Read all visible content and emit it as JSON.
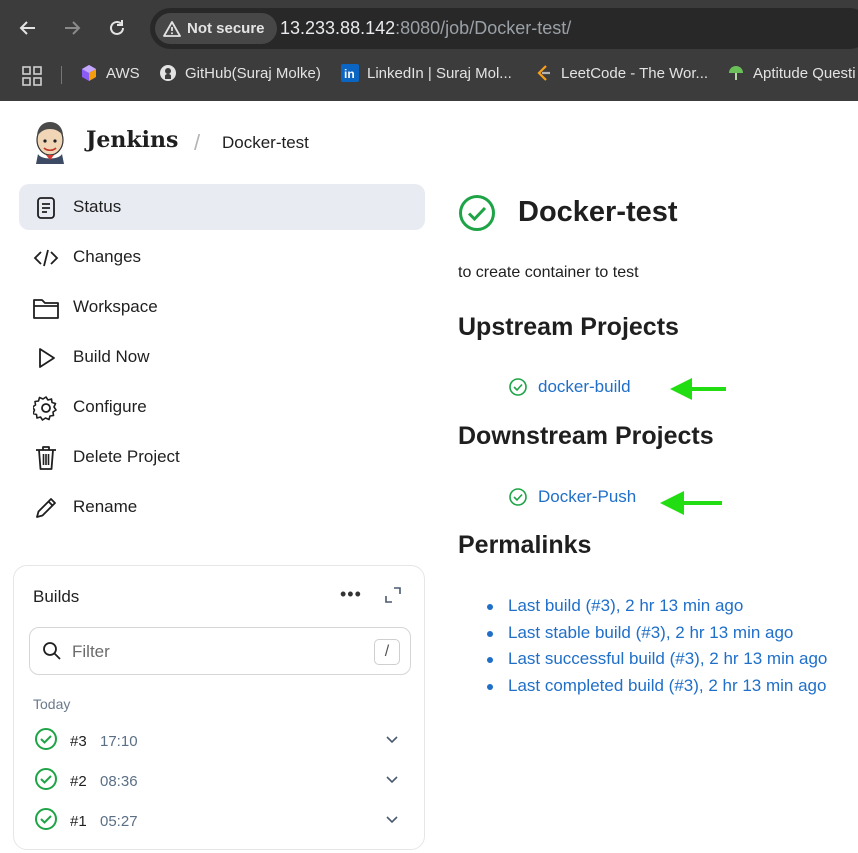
{
  "browser": {
    "security_label": "Not secure",
    "url_host": "13.233.88.142",
    "url_rest": ":8080/job/Docker-test/",
    "bookmarks": [
      {
        "label": "AWS",
        "icon": "aws-cube-icon"
      },
      {
        "label": "GitHub(Suraj Molke)",
        "icon": "github-icon"
      },
      {
        "label": "LinkedIn | Suraj Mol...",
        "icon": "linkedin-icon"
      },
      {
        "label": "LeetCode - The Wor...",
        "icon": "leetcode-icon"
      },
      {
        "label": "Aptitude Questi",
        "icon": "aptitude-icon"
      }
    ]
  },
  "header": {
    "brand": "Jenkins",
    "separator": "/",
    "breadcrumb": "Docker-test"
  },
  "sidebar": {
    "items": [
      {
        "label": "Status",
        "icon": "status-document-icon",
        "active": true
      },
      {
        "label": "Changes",
        "icon": "code-icon"
      },
      {
        "label": "Workspace",
        "icon": "folder-icon"
      },
      {
        "label": "Build Now",
        "icon": "play-icon"
      },
      {
        "label": "Configure",
        "icon": "gear-icon"
      },
      {
        "label": "Delete Project",
        "icon": "trash-icon"
      },
      {
        "label": "Rename",
        "icon": "pencil-icon"
      }
    ]
  },
  "builds": {
    "title": "Builds",
    "more": "•••",
    "filter_placeholder": "Filter",
    "filter_shortcut": "/",
    "group_label": "Today",
    "rows": [
      {
        "number": "#3",
        "time": "17:10",
        "status": "success"
      },
      {
        "number": "#2",
        "time": "08:36",
        "status": "success"
      },
      {
        "number": "#1",
        "time": "05:27",
        "status": "success"
      }
    ]
  },
  "main": {
    "title": "Docker-test",
    "description": "to create container to test",
    "upstream_heading": "Upstream Projects",
    "upstream_project": "docker-build",
    "downstream_heading": "Downstream Projects",
    "downstream_project": "Docker-Push",
    "permalinks_heading": "Permalinks",
    "permalinks": [
      "Last build (#3), 2 hr 13 min ago",
      "Last stable build (#3), 2 hr 13 min ago",
      "Last successful build (#3), 2 hr 13 min ago",
      "Last completed build (#3), 2 hr 13 min ago"
    ]
  },
  "colors": {
    "success": "#1ea446",
    "link": "#1f6fc9",
    "annotation_arrow": "#22dd11",
    "chrome_bg": "#3c3c3c"
  }
}
